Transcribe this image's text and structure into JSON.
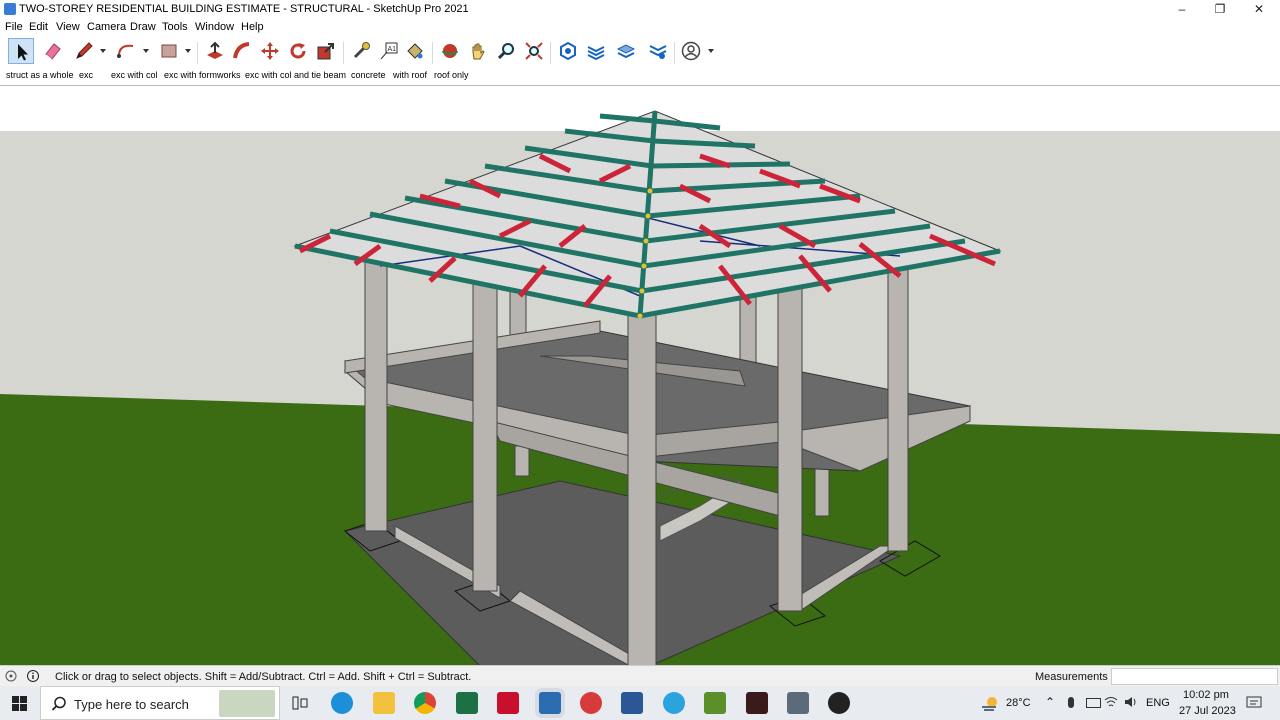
{
  "window": {
    "title": "TWO-STOREY RESIDENTIAL BUILDING ESTIMATE - STRUCTURAL - SketchUp Pro 2021"
  },
  "menu": [
    "File",
    "Edit",
    "View",
    "Camera",
    "Draw",
    "Tools",
    "Window",
    "Help"
  ],
  "toolbar": {
    "tools": [
      "select-icon",
      "eraser-icon",
      "pencil-icon",
      "arc-icon",
      "rectangle-icon",
      "push-pull-icon",
      "follow-me-icon",
      "move-icon",
      "rotate-icon",
      "scale-icon",
      "tape-measure-icon",
      "text-icon",
      "paint-bucket-icon",
      "orbit-icon",
      "pan-icon",
      "zoom-icon",
      "zoom-extents-icon",
      "warehouse-icon",
      "extension-warehouse-icon",
      "layout-icon",
      "extension-manager-icon",
      "account-icon"
    ]
  },
  "scenes": {
    "tabs": [
      "struct as a whole",
      "exc",
      "exc with col",
      "exc with formworks",
      "exc with col and tie beam",
      "concrete",
      "with roof",
      "roof only"
    ],
    "active": "with roof"
  },
  "status": {
    "hint": "Click or drag to select objects. Shift = Add/Subtract. Ctrl = Add. Shift + Ctrl = Subtract.",
    "measurements_label": "Measurements",
    "measurements_value": ""
  },
  "taskbar": {
    "search_placeholder": "Type here to search",
    "apps": [
      "task-view-icon",
      "edge-icon",
      "file-explorer-icon",
      "chrome-icon",
      "excel-icon",
      "acrobat-icon",
      "sketchup-icon",
      "layout-app-icon",
      "word-icon",
      "telegram-icon",
      "android-icon",
      "media-icon",
      "calculator-icon",
      "recorder-icon"
    ],
    "weather": "28°C",
    "language": "ENG",
    "time": "10:02 pm",
    "date": "27 Jul 2023"
  },
  "colors": {
    "sky": "#d6d6d1",
    "ground": "#3b6b12",
    "concrete": "#b8b5b0",
    "purlin": "#1f7466",
    "rafter": "#cc2438"
  }
}
